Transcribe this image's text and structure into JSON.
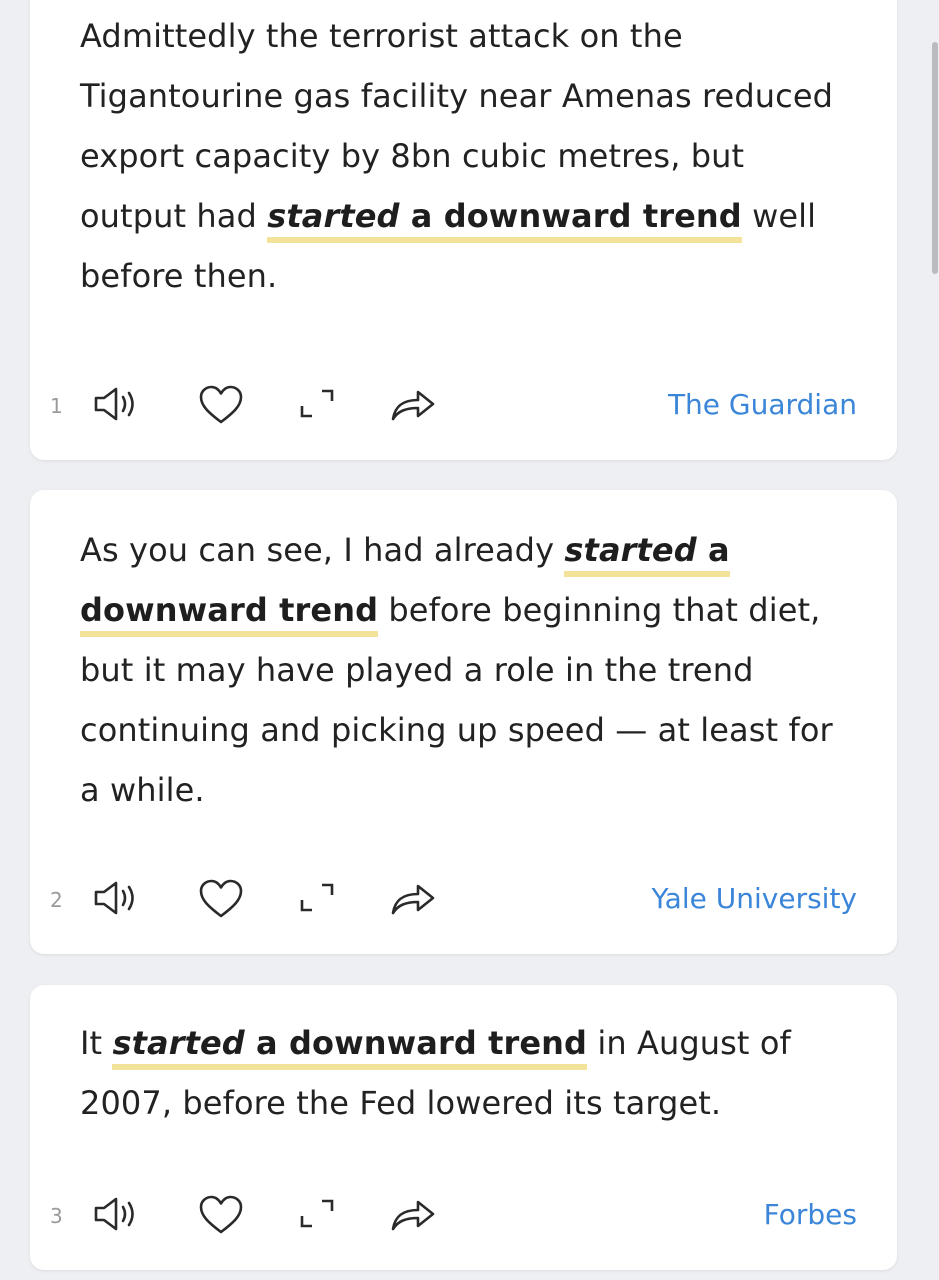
{
  "results": [
    {
      "index": "1",
      "parts": {
        "pre": "Admittedly the terrorist attack on the Tigantourine gas facility near Amenas reduced export capacity by 8bn cubic metres, but output had ",
        "kw_italic": "started",
        "kw_space": " ",
        "kw_rest": "a downward trend",
        "post": " well before then."
      },
      "source": "The Guardian"
    },
    {
      "index": "2",
      "parts": {
        "pre": "As you can see, I had already ",
        "kw_italic": "started",
        "kw_space": " ",
        "kw_rest": "a downward trend",
        "post": " before beginning that diet, but it may have played a role in the trend continuing and picking up speed — at least for a while."
      },
      "source": "Yale University"
    },
    {
      "index": "3",
      "parts": {
        "pre": "It ",
        "kw_italic": "started",
        "kw_space": " ",
        "kw_rest": "a downward trend",
        "post": " in August of 2007, before the Fed lowered its target."
      },
      "source": "Forbes"
    }
  ],
  "icons": {
    "play": "speaker-icon",
    "favorite": "heart-icon",
    "expand": "expand-icon",
    "share": "share-icon"
  },
  "colors": {
    "highlight_underline": "#f3e39a",
    "source_link": "#3b86d8",
    "card_background": "#ffffff",
    "page_background": "#eeeff2"
  }
}
